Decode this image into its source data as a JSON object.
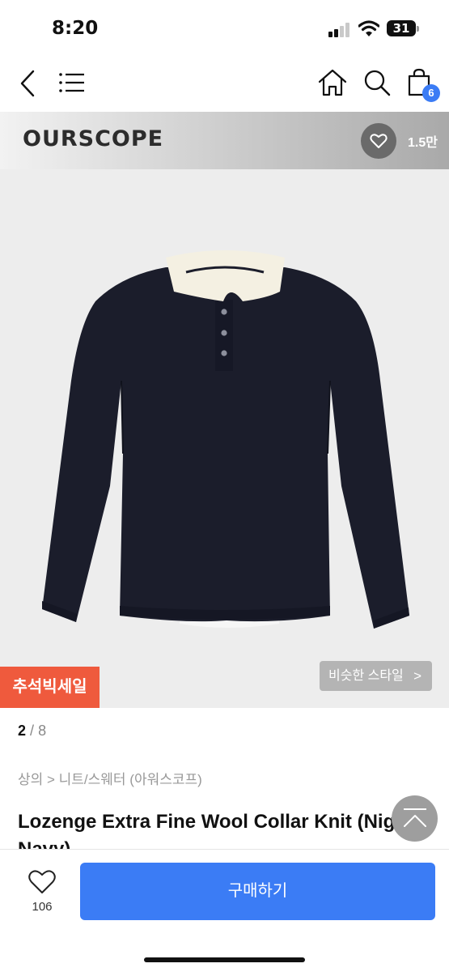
{
  "status_bar": {
    "time": "8:20",
    "battery": "31"
  },
  "nav": {
    "back_icon": "chevron-left-icon",
    "menu_icon": "menu-icon",
    "home_icon": "home-icon",
    "search_icon": "search-icon",
    "cart_icon": "shopping-bag-icon",
    "cart_count": "6"
  },
  "brand": {
    "name": "OURSCOPE",
    "likes": "1.5만"
  },
  "product": {
    "sale_badge": "추석빅세일",
    "similar_style": "비슷한 스타일",
    "similar_chevron": ">",
    "image_index": "2",
    "image_sep": "/",
    "image_total": "8",
    "breadcrumb": "상의 > 니트/스웨터 (아워스코프)",
    "title": "Lozenge Extra Fine Wool Collar Knit (Night Navy)"
  },
  "bottom": {
    "wish_count": "106",
    "buy_label": "구매하기"
  },
  "colors": {
    "accent": "#3b7cf5",
    "sale": "#ef5a3d",
    "knit": "#1b1d2b",
    "collar": "#f4f0e2"
  }
}
